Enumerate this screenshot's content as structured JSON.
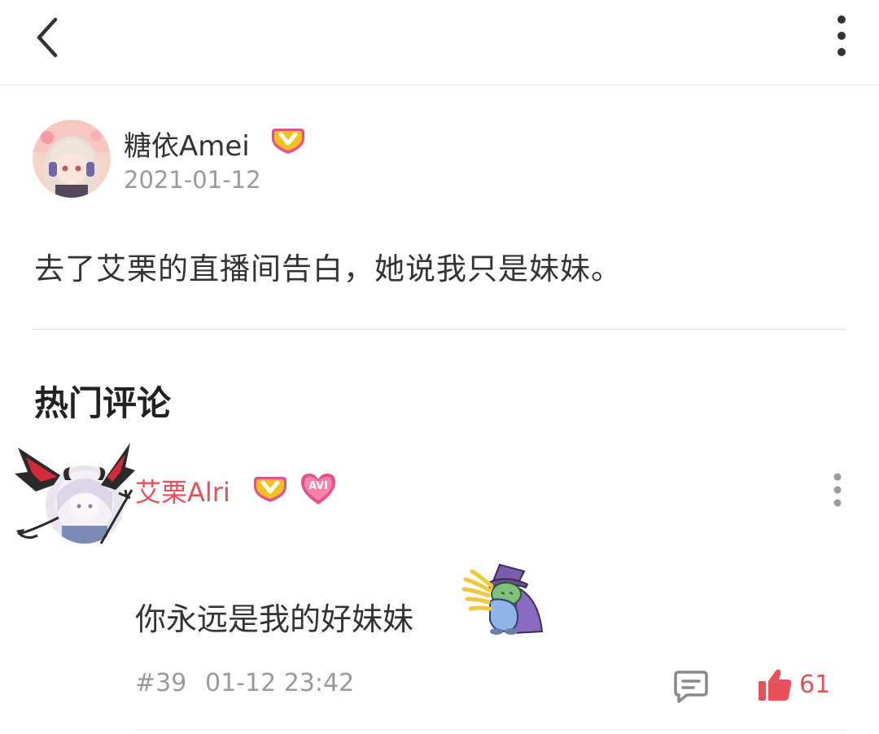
{
  "header": {
    "back_icon": "chevron-left-icon",
    "more_icon": "vertical-dots-icon"
  },
  "post": {
    "author_name": "糖依Amei",
    "author_badge_icon": "yellow-v-badge-icon",
    "date": "2021-01-12",
    "text": "去了艾栗的直播间告白，她说我只是妹妹。"
  },
  "section": {
    "title": "热门评论"
  },
  "comment": {
    "author_name": "艾栗Alri",
    "badges": [
      "yellow-v-badge-icon",
      "pink-heart-avi-badge-icon"
    ],
    "badge_heart_text": "AVI",
    "text": "你永远是我的好妹妹",
    "sticker_icon": "wizard-sticker-icon",
    "floor": "#39",
    "time": "01-12 23:42",
    "reply_icon": "comment-icon",
    "like_icon": "thumbs-up-icon",
    "likes": "61"
  },
  "colors": {
    "accent_red": "#e8505b",
    "badge_yellow": "#f5c21b",
    "badge_pink": "#e8508c",
    "muted_text": "#9a9a9a"
  }
}
